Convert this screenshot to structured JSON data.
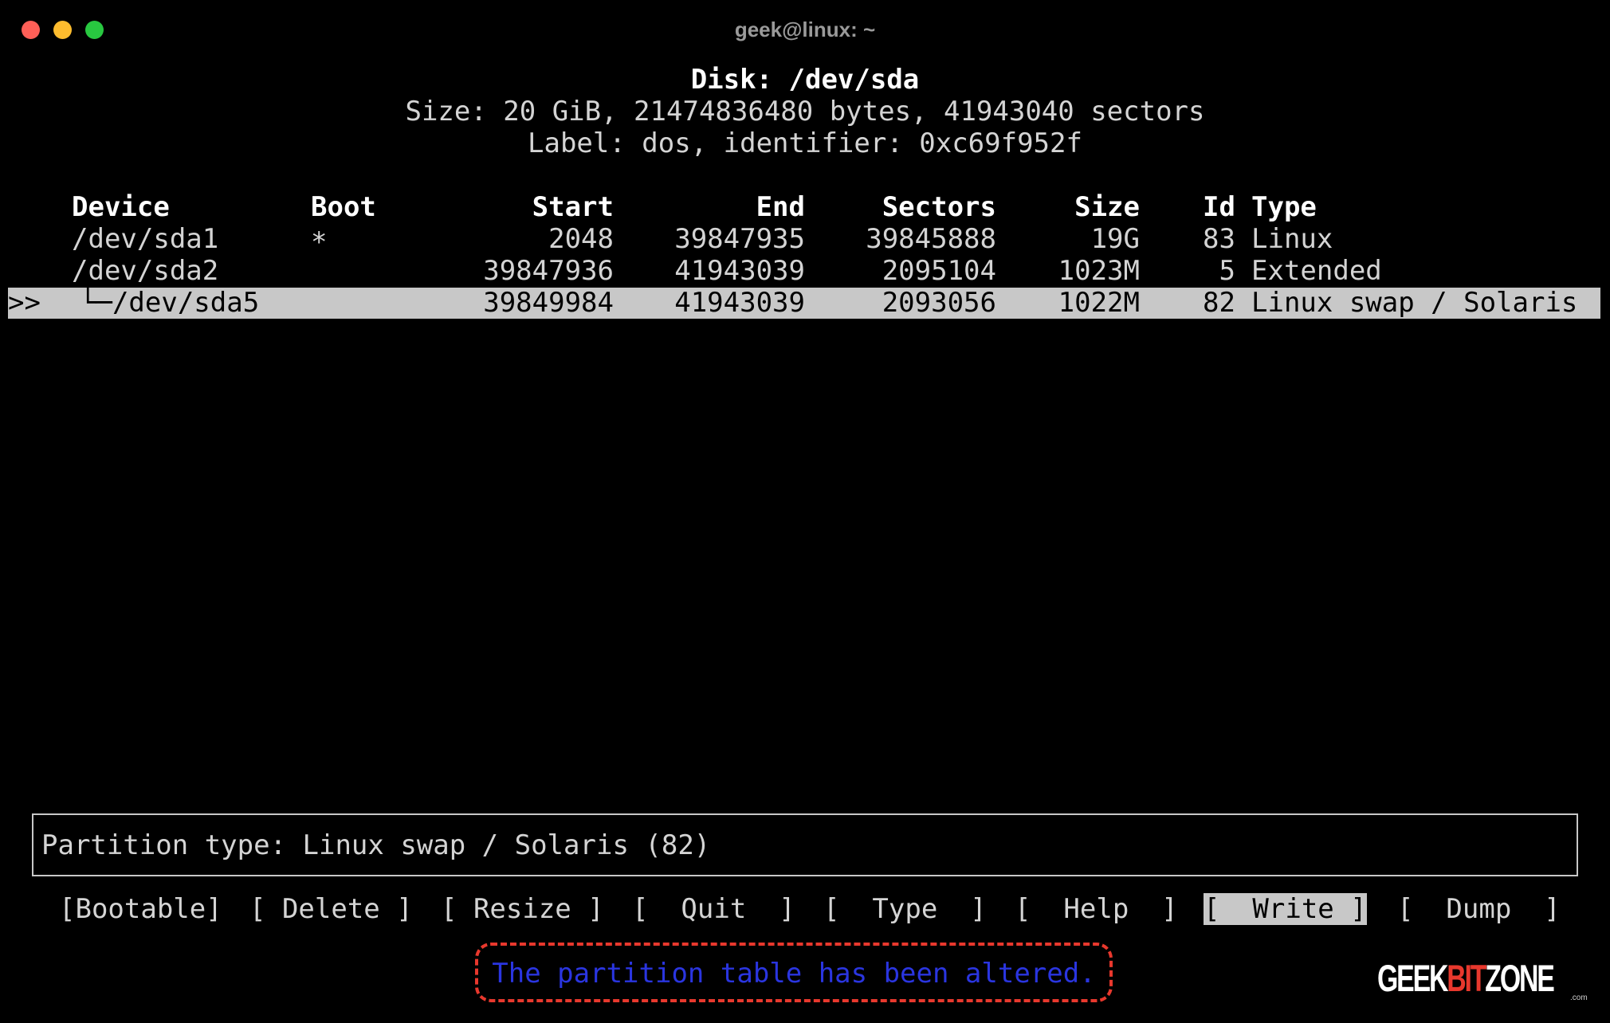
{
  "window": {
    "title": "geek@linux: ~"
  },
  "disk": {
    "title": "Disk: /dev/sda",
    "size_line": "Size: 20 GiB, 21474836480 bytes, 41943040 sectors",
    "label_line": "Label: dos, identifier: 0xc69f952f"
  },
  "table": {
    "headers": {
      "device": "Device",
      "boot": "Boot",
      "start": "Start",
      "end": "End",
      "sectors": "Sectors",
      "size": "Size",
      "id": "Id",
      "type": "Type"
    },
    "rows": [
      {
        "device": "/dev/sda1",
        "boot": "*",
        "start": "2048",
        "end": "39847935",
        "sectors": "39845888",
        "size": "19G",
        "id": "83",
        "type": "Linux"
      },
      {
        "device": "/dev/sda2",
        "boot": "",
        "start": "39847936",
        "end": "41943039",
        "sectors": "2095104",
        "size": "1023M",
        "id": "5",
        "type": "Extended"
      },
      {
        "marker": ">>",
        "device": "└─/dev/sda5",
        "boot": "",
        "start": "39849984",
        "end": "41943039",
        "sectors": "2093056",
        "size": "1022M",
        "id": "82",
        "type": "Linux swap / Solaris"
      }
    ]
  },
  "info": {
    "text": "Partition type: Linux swap / Solaris (82)"
  },
  "menu": {
    "bootable": "[Bootable]",
    "delete": "[ Delete ]",
    "resize": "[ Resize ]",
    "quit": "[  Quit  ]",
    "type": "[  Type  ]",
    "help": "[  Help  ]",
    "write": "[  Write ]",
    "dump": "[  Dump  ]"
  },
  "status": {
    "message": "The partition table has been altered."
  },
  "logo": {
    "part1": "GEEK",
    "part2": "BIT",
    "part3": "ZONE",
    "suffix": ".com"
  },
  "colors": {
    "highlight": "#c8c8c8",
    "status_text": "#2a35e0",
    "status_border": "#e8382d"
  }
}
